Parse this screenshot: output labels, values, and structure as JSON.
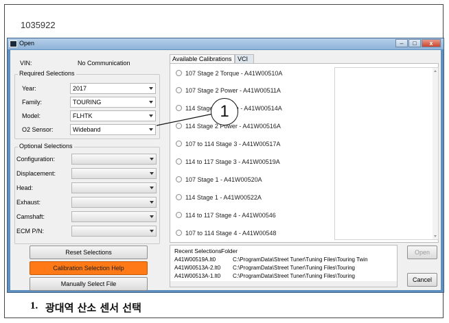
{
  "doc_id": "1035922",
  "window": {
    "title": "Open",
    "minimize": "–",
    "maximize": "□",
    "close": "x"
  },
  "vin": {
    "label": "VIN:",
    "value": "No Communication"
  },
  "required": {
    "title": "Required Selections",
    "fields": [
      {
        "label": "Year:",
        "value": "2017"
      },
      {
        "label": "Family:",
        "value": "TOURING"
      },
      {
        "label": "Model:",
        "value": "FLHTK"
      },
      {
        "label": "O2 Sensor:",
        "value": "Wideband"
      }
    ]
  },
  "optional": {
    "title": "Optional Selections",
    "fields": [
      {
        "label": "Configuration:",
        "value": ""
      },
      {
        "label": "Displacement:",
        "value": ""
      },
      {
        "label": "Head:",
        "value": ""
      },
      {
        "label": "Exhaust:",
        "value": ""
      },
      {
        "label": "Camshaft:",
        "value": ""
      },
      {
        "label": "ECM P/N:",
        "value": ""
      }
    ]
  },
  "buttons": {
    "reset": "Reset Selections",
    "help": "Calibration Selection Help",
    "manual": "Manually Select File",
    "open": "Open",
    "cancel": "Cancel"
  },
  "tabs": [
    {
      "label": "Available Calibrations",
      "active": true
    },
    {
      "label": "VCI",
      "active": false
    }
  ],
  "calibrations": [
    "107 Stage 2 Torque - A41W00510A",
    "107 Stage 2 Power - A41W00511A",
    "114 Stage 2 Torque - A41W00514A",
    "114 Stage 2 Power - A41W00516A",
    "107 to 114 Stage 3 - A41W00517A",
    "114 to 117 Stage 3 - A41W00519A",
    "107 Stage 1 - A41W00520A",
    "114 Stage 1 - A41W00522A",
    "114 to 117 Stage 4 - A41W00546",
    "107 to 114 Stage 4 - A41W00548"
  ],
  "recent": {
    "col_file": "Recent Selections",
    "col_folder": "Folder",
    "rows": [
      {
        "file": "A41W00519A.lt0",
        "folder": "C:\\ProgramData\\Street Tuner\\Tuning Files\\Touring Twin"
      },
      {
        "file": "A41W00513A-2.lt0",
        "folder": "C:\\ProgramData\\Street Tuner\\Tuning Files\\Touring"
      },
      {
        "file": "A41W00513A-1.lt0",
        "folder": "C:\\ProgramData\\Street Tuner\\Tuning Files\\Touring"
      }
    ]
  },
  "callout": {
    "number": "1"
  },
  "caption": {
    "number": "1.",
    "text": "광대역 산소 센서 선택"
  },
  "colors": {
    "help_button": "#ff7a16",
    "titlebar": "#8fb3d9"
  }
}
